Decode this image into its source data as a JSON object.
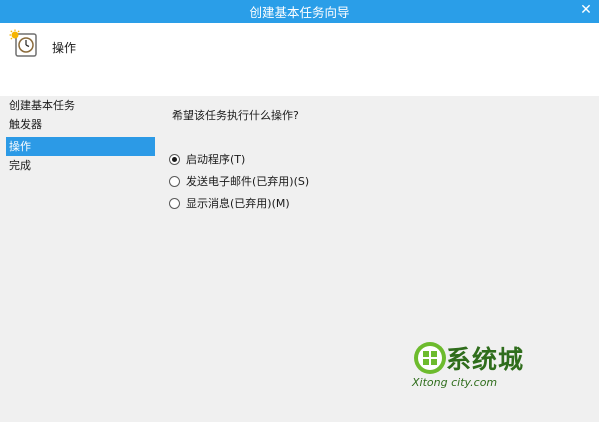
{
  "window": {
    "title": "创建基本任务向导",
    "close_glyph": "✕"
  },
  "header": {
    "title": "操作",
    "icon": "task-scheduler-clock-icon"
  },
  "nav": {
    "items": [
      {
        "label": "创建基本任务",
        "active": false
      },
      {
        "label": "触发器",
        "active": false
      },
      {
        "label": "操作",
        "active": true
      },
      {
        "label": "完成",
        "active": false
      }
    ]
  },
  "content": {
    "question": "希望该任务执行什么操作?",
    "options": [
      {
        "label": "启动程序(T)",
        "checked": true
      },
      {
        "label": "发送电子邮件(已弃用)(S)",
        "checked": false
      },
      {
        "label": "显示消息(已弃用)(M)",
        "checked": false
      }
    ]
  },
  "watermark": {
    "text": "系统城",
    "sub": "Xitong city.com"
  },
  "colors": {
    "titlebar": "#2a9ee8",
    "selection": "#2c9ae6",
    "watermark": "#2f6d1c"
  }
}
